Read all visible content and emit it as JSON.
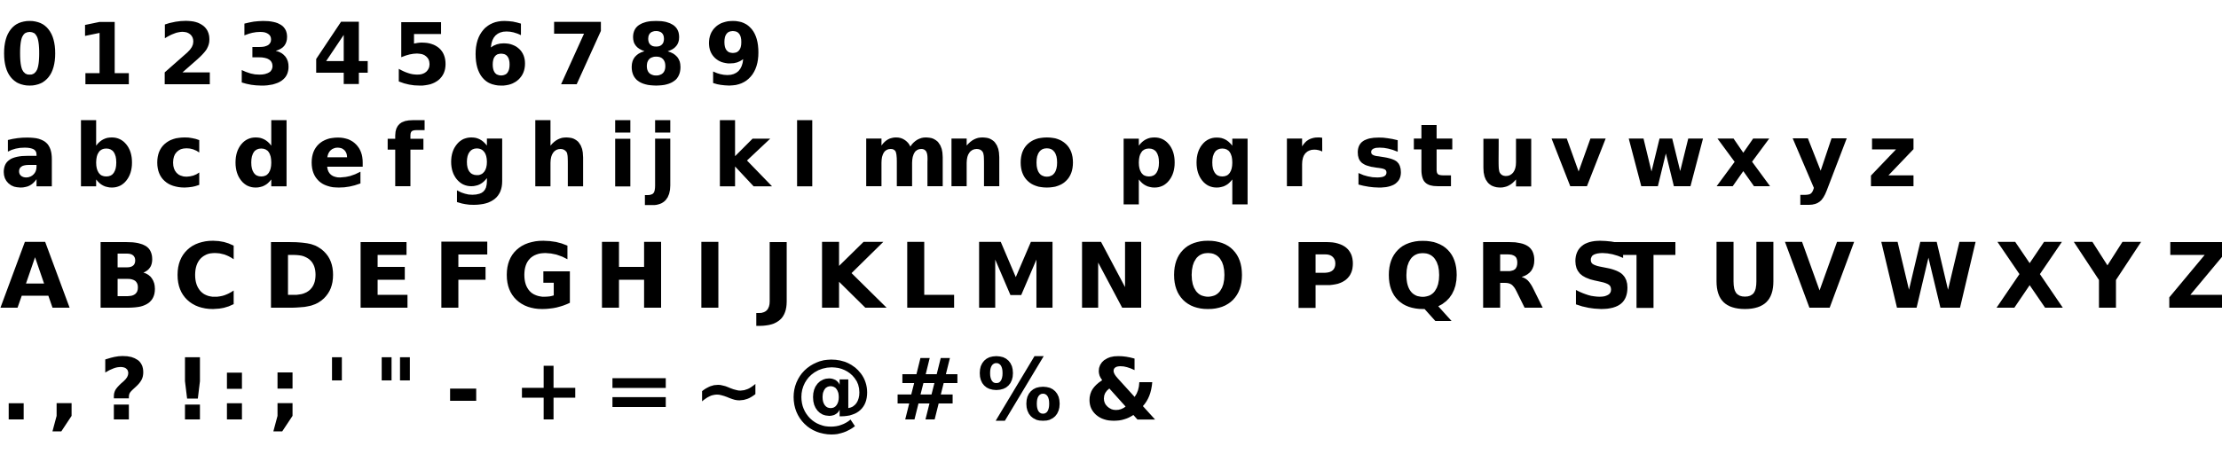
{
  "rows": [
    {
      "name": "digits",
      "glyphs": [
        "0",
        "1",
        "2",
        "3",
        "4",
        "5",
        "6",
        "7",
        "8",
        "9"
      ]
    },
    {
      "name": "lowercase",
      "glyphs": [
        "a",
        "b",
        "c",
        "d",
        "e",
        "f",
        "g",
        "h",
        "i",
        "j",
        "k",
        "l",
        "m",
        "n",
        "o",
        "p",
        "q",
        "r",
        "s",
        "t",
        "u",
        "v",
        "w",
        "x",
        "y",
        "z"
      ]
    },
    {
      "name": "uppercase",
      "glyphs": [
        "A",
        "B",
        "C",
        "D",
        "E",
        "F",
        "G",
        "H",
        "I",
        "J",
        "K",
        "L",
        "M",
        "N",
        "O",
        "P",
        "Q",
        "R",
        "S",
        "T",
        "U",
        "V",
        "W",
        "X",
        "Y",
        "Z"
      ]
    },
    {
      "name": "punctuation",
      "glyphs": [
        ".",
        ",",
        "?",
        "!",
        ":",
        ";",
        "'",
        "\"",
        "-",
        "+",
        "=",
        "~",
        "@",
        "#",
        "%",
        "&"
      ]
    }
  ],
  "colors": {
    "text": "#000000",
    "background": "#ffffff"
  }
}
